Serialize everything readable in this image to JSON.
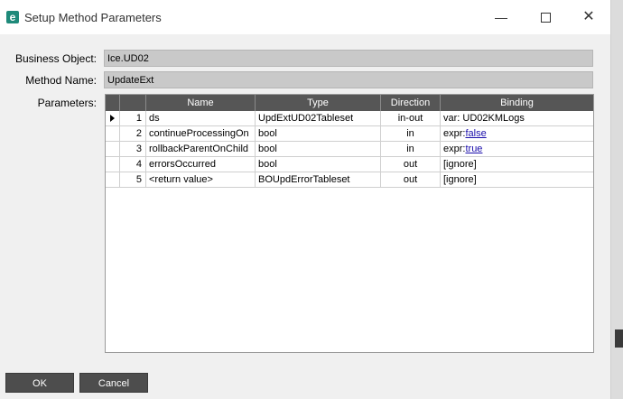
{
  "window": {
    "title": "Setup Method Parameters",
    "icon": "epicor-e-icon",
    "minimize_glyph": "—",
    "close_glyph": "✕"
  },
  "form": {
    "business_object_label": "Business Object:",
    "business_object_value": "Ice.UD02",
    "method_name_label": "Method Name:",
    "method_name_value": "UpdateExt",
    "parameters_label": "Parameters:"
  },
  "grid": {
    "columns": [
      "Name",
      "Type",
      "Direction",
      "Binding"
    ],
    "rows": [
      {
        "num": "1",
        "name": "ds",
        "type": "UpdExtUD02Tableset",
        "direction": "in-out",
        "binding_prefix": "var: UD02KMLogs",
        "binding_link": "",
        "selected": true
      },
      {
        "num": "2",
        "name": "continueProcessingOn",
        "type": "bool",
        "direction": "in",
        "binding_prefix": "expr:",
        "binding_link": "false",
        "selected": false
      },
      {
        "num": "3",
        "name": "rollbackParentOnChild",
        "type": "bool",
        "direction": "in",
        "binding_prefix": "expr:",
        "binding_link": "true",
        "selected": false
      },
      {
        "num": "4",
        "name": "errorsOccurred",
        "type": "bool",
        "direction": "out",
        "binding_prefix": "[ignore]",
        "binding_link": "",
        "selected": false
      },
      {
        "num": "5",
        "name": "<return value>",
        "type": "BOUpdErrorTableset",
        "direction": "out",
        "binding_prefix": "[ignore]",
        "binding_link": "",
        "selected": false
      }
    ]
  },
  "buttons": {
    "ok": "OK",
    "cancel": "Cancel"
  },
  "colors": {
    "header_bg": "#565656",
    "field_bg": "#c9c9c9",
    "button_bg": "#4d4d4d",
    "link": "#1a0dab"
  }
}
